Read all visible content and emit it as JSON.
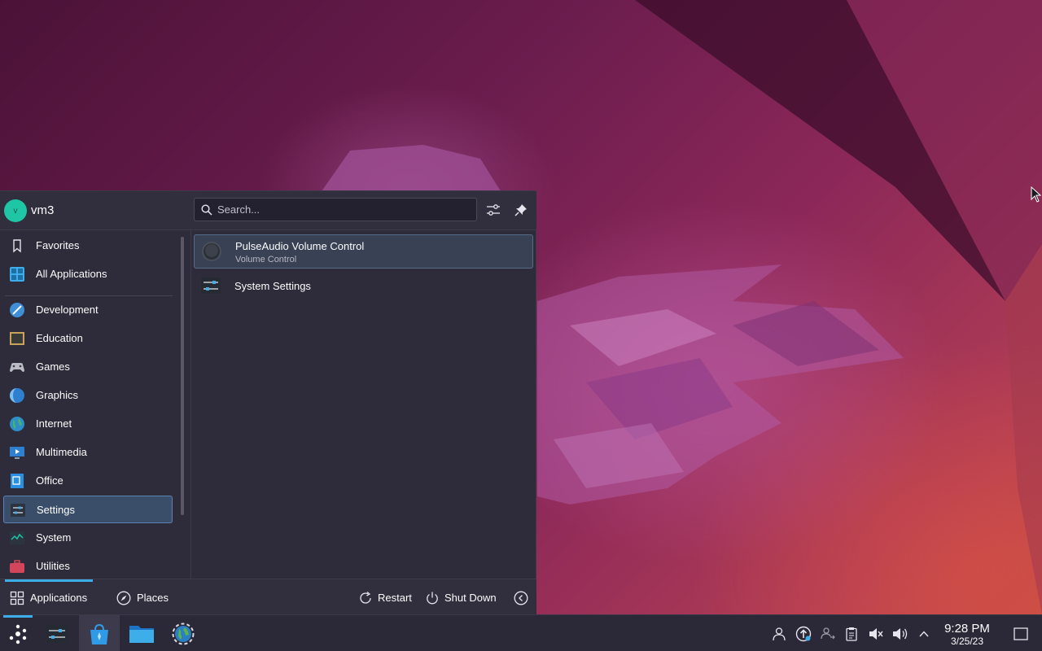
{
  "user": {
    "avatar_letter": "v",
    "name": "vm3"
  },
  "search": {
    "placeholder": "Search...",
    "value": ""
  },
  "categories": [
    {
      "label": "Favorites",
      "icon": "bookmark-icon"
    },
    {
      "label": "All Applications",
      "icon": "grid-icon"
    },
    {
      "label": "Development",
      "icon": "development-icon"
    },
    {
      "label": "Education",
      "icon": "education-icon"
    },
    {
      "label": "Games",
      "icon": "gamepad-icon"
    },
    {
      "label": "Graphics",
      "icon": "graphics-icon"
    },
    {
      "label": "Internet",
      "icon": "globe-icon"
    },
    {
      "label": "Multimedia",
      "icon": "multimedia-icon"
    },
    {
      "label": "Office",
      "icon": "office-icon"
    },
    {
      "label": "Settings",
      "icon": "settings-icon",
      "selected": true
    },
    {
      "label": "System",
      "icon": "system-icon"
    },
    {
      "label": "Utilities",
      "icon": "utilities-icon"
    }
  ],
  "apps": [
    {
      "title": "PulseAudio Volume Control",
      "subtitle": "Volume Control",
      "icon": "volume-knob-icon",
      "selected": true
    },
    {
      "title": "System Settings",
      "subtitle": "",
      "icon": "system-settings-icon"
    }
  ],
  "footer": {
    "tabs": [
      {
        "label": "Applications",
        "icon": "grid-icon",
        "active": true
      },
      {
        "label": "Places",
        "icon": "compass-icon"
      }
    ],
    "actions": [
      {
        "label": "Restart",
        "icon": "restart-icon"
      },
      {
        "label": "Shut Down",
        "icon": "power-icon"
      }
    ]
  },
  "taskbar": {
    "items": [
      "application-launcher-icon",
      "system-settings-icon",
      "discover-icon",
      "file-manager-icon",
      "web-browser-icon"
    ],
    "tray": [
      "user-icon",
      "update-icon",
      "kde-connect-icon",
      "clipboard-icon",
      "muted-speaker-icon",
      "volume-icon",
      "chevron-up-icon"
    ],
    "clock": {
      "time": "9:28 PM",
      "date": "3/25/23"
    }
  },
  "colors": {
    "panel": "#2e2c3a",
    "accent": "#3daee9",
    "selection": "#3b4e69",
    "avatar": "#1fc6a6"
  }
}
